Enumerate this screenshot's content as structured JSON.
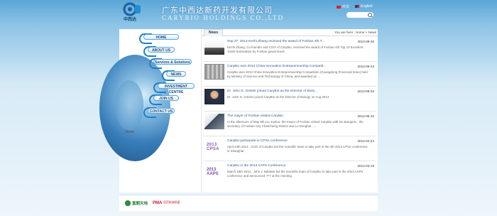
{
  "header": {
    "logo_text": "中西达",
    "company_cn": "广东中西达新药开发有限公司",
    "company_en": "CARYBIO HOLDINGS CO.,LTD",
    "lang_cn": "中文",
    "lang_en": "English",
    "search_placeholder": ""
  },
  "nav": {
    "items": [
      {
        "label": "HOME"
      },
      {
        "label": "ABOUT US"
      },
      {
        "label": "Services & Solutions"
      },
      {
        "label": "NEWS"
      },
      {
        "label": "INVESTMENT CENTRE"
      },
      {
        "label": "JOIN US"
      },
      {
        "label": "CONTACT US"
      }
    ],
    "left_news": "News"
  },
  "main": {
    "tab": "News",
    "breadcrumb": "You are here : Home > News",
    "news": [
      {
        "title": "Sep 27, 2013 Kezhi Zhang received the award of Foshan 4th T...",
        "date": "2013-09-30",
        "summary": "Kezhi Zhang, Co-founder and COO of CaryBio, received the award of Foshan 4th Top 10 Excellent Youth Nomination by Foshan government."
      },
      {
        "title": "CaryBio won 2013 China Innovation Entrepreneurship Competit...",
        "date": "2013-09-23",
        "summary": "CaryBio won 2013 China Innovation Entrepreneurship Competition (Guangdong Provincial Zone) held by Ministry of Science and Technology of China, and awarded as ..."
      },
      {
        "title": "Dr. John G. Geisler joined CaryBio as the Director of Biolo...",
        "date": "2013-09-02",
        "summary": "Dr. John G. Geisler joined CaryBio as the Director of Biology on Aug 2013"
      },
      {
        "title": "The mayor of Foshan visited CaryBio",
        "date": "2013-05-10",
        "summary": "In the afternoon of May 9th,Liu Yuelun, the mayor of Foshan visited CaryBio with Ou Bangmin , the secretary of Foshan City Chancheng District and Lu Donghai , ..."
      },
      {
        "title": "CaryBio participate in CPSA conference",
        "date": "2013-04-24",
        "summary": "April 24th 2013 , COO of CaryBio led the scientific team to take part in the 4th 2013 CPSA conference in Shanghai.",
        "thumb_text": "2013 CPSA"
      },
      {
        "title": "CaryBio in the 2013 AAPS Conference",
        "date": "2013-03-19",
        "summary": "March 18th 2013 , John J. Baldwin led the scientific team of CaryBio to take part in the 2013 AAPS conference and announced ??? at the meeting.",
        "thumb_text": "2013 AAPS"
      }
    ]
  },
  "footer": {
    "logo1": "富朗天地",
    "logo2_mark": "PMA",
    "logo2_text": "医药制造联盟"
  },
  "colors": {
    "nav_accent": "#1e7fc4",
    "link": "#2a5b8f",
    "sky": "#5aa6d8"
  }
}
